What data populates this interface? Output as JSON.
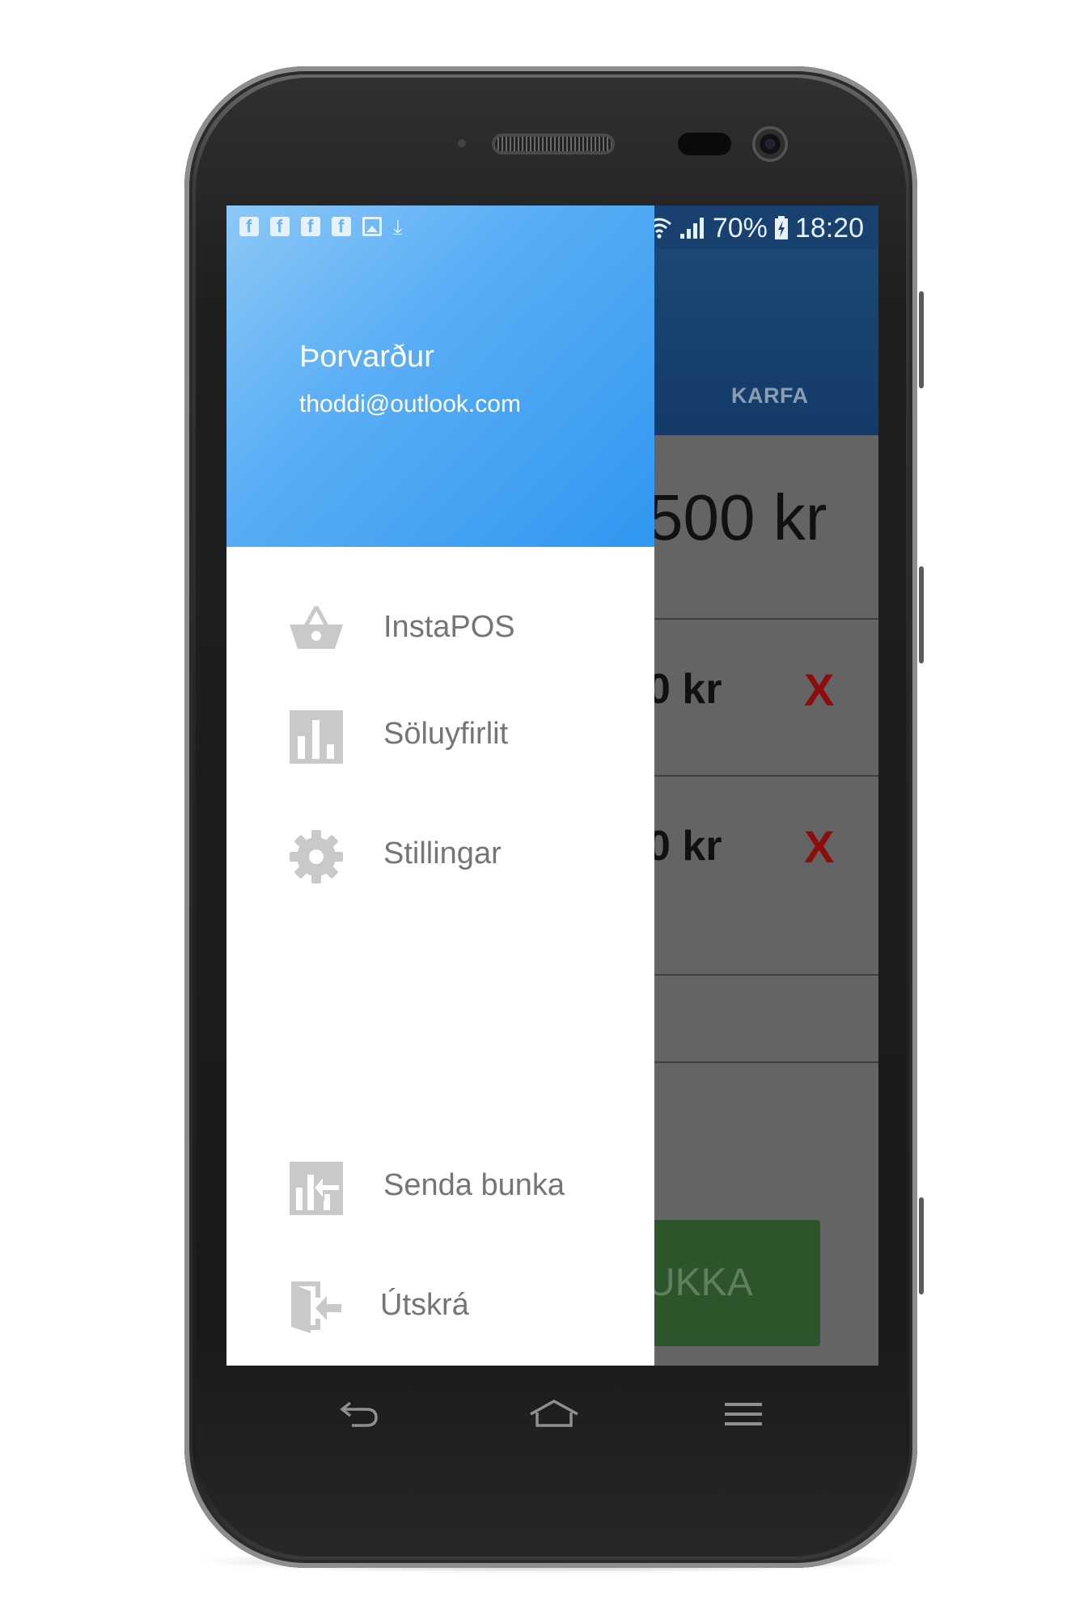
{
  "status_bar": {
    "battery": "70%",
    "time": "18:20",
    "left_icons": [
      "facebook-icon",
      "facebook-icon",
      "facebook-icon",
      "facebook-icon",
      "image-icon",
      "download-icon"
    ],
    "right_icons": [
      "bluetooth-icon",
      "wifi-icon",
      "signal-icon",
      "battery-charging-icon"
    ]
  },
  "drawer": {
    "user_name": "Þorvarður",
    "user_email": "thoddi@outlook.com",
    "items": [
      {
        "label": "InstaPOS",
        "icon": "basket-icon"
      },
      {
        "label": "Söluyfirlit",
        "icon": "bar-chart-icon"
      },
      {
        "label": "Stillingar",
        "icon": "gear-icon"
      },
      {
        "label": "Senda bunka",
        "icon": "send-batch-icon"
      },
      {
        "label": "Útskrá",
        "icon": "logout-icon"
      }
    ]
  },
  "background_app": {
    "tab_label": "KARFA",
    "total": "500 kr",
    "items": [
      {
        "price": "0 kr",
        "remove": "X"
      },
      {
        "price": "0 kr",
        "remove": "X"
      }
    ],
    "action_button": "UKKA"
  },
  "colors": {
    "drawer_header_start": "#8cc8f7",
    "drawer_header_end": "#2f97f0",
    "app_header": "#133b67",
    "remove_x": "#8d0c0c",
    "action_button": "#2c552c"
  }
}
